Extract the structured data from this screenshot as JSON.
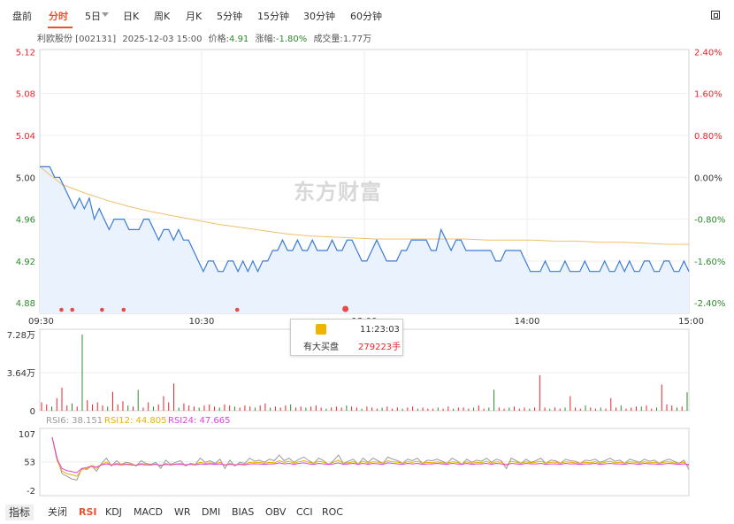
{
  "tabs": [
    {
      "label": "盘前",
      "active": false
    },
    {
      "label": "分时",
      "active": true
    },
    {
      "label": "5日",
      "active": false
    },
    {
      "label": "日K",
      "active": false
    },
    {
      "label": "周K",
      "active": false
    },
    {
      "label": "月K",
      "active": false
    },
    {
      "label": "5分钟",
      "active": false
    },
    {
      "label": "15分钟",
      "active": false
    },
    {
      "label": "30分钟",
      "active": false
    },
    {
      "label": "60分钟",
      "active": false
    }
  ],
  "info": {
    "stock": "利欧股份 [002131]",
    "datetime": "2025-12-03 15:00",
    "price_label": "价格:",
    "price": "4.91",
    "change_label": "涨幅:",
    "change": "-1.80%",
    "volume_label": "成交量:",
    "volume": "1.77万"
  },
  "watermark": "东方财富",
  "tooltip": {
    "label": "有大买盘",
    "time": "11:23:03",
    "volume": "279223手"
  },
  "bottom_tabs": [
    {
      "label": "指标",
      "active": false
    },
    {
      "label": "关闭",
      "active": false
    },
    {
      "label": "RSI",
      "active": true
    },
    {
      "label": "KDJ",
      "active": false
    },
    {
      "label": "MACD",
      "active": false
    },
    {
      "label": "WR",
      "active": false
    },
    {
      "label": "DMI",
      "active": false
    },
    {
      "label": "BIAS",
      "active": false
    },
    {
      "label": "OBV",
      "active": false
    },
    {
      "label": "CCI",
      "active": false
    },
    {
      "label": "ROC",
      "active": false
    }
  ],
  "colors": {
    "up": "#e8242b",
    "down": "#2d8a2d",
    "price_line": "#3a7bd5",
    "avg_line": "#f0c06a",
    "rsi6": "#9a9a9a",
    "rsi12": "#e8b000",
    "rsi24": "#e040e0"
  },
  "chart_data": [
    {
      "type": "line",
      "title": "",
      "x_ticks": [
        "09:30",
        "10:30",
        "13:00",
        "14:00",
        "15:00"
      ],
      "y_ticks": [
        "5.12",
        "5.08",
        "5.04",
        "5.00",
        "4.96",
        "4.92",
        "4.88"
      ],
      "pct_ticks": [
        "2.40%",
        "1.60%",
        "0.80%",
        "0.00%",
        "-0.80%",
        "-1.60%",
        "-2.40%"
      ],
      "ylim": [
        4.87,
        5.122
      ],
      "base_price": 5.0,
      "series": [
        {
          "name": "price",
          "values": [
            5.01,
            5.01,
            5.01,
            5.0,
            5.0,
            4.99,
            4.98,
            4.97,
            4.98,
            4.97,
            4.98,
            4.96,
            4.97,
            4.96,
            4.95,
            4.96,
            4.96,
            4.96,
            4.95,
            4.95,
            4.95,
            4.96,
            4.96,
            4.95,
            4.94,
            4.95,
            4.95,
            4.94,
            4.95,
            4.94,
            4.94,
            4.93,
            4.92,
            4.91,
            4.92,
            4.92,
            4.91,
            4.91,
            4.92,
            4.92,
            4.91,
            4.92,
            4.91,
            4.92,
            4.91,
            4.92,
            4.92,
            4.93,
            4.93,
            4.94,
            4.93,
            4.93,
            4.94,
            4.93,
            4.93,
            4.94,
            4.93,
            4.93,
            4.93,
            4.94,
            4.93,
            4.93,
            4.94,
            4.94,
            4.93,
            4.92,
            4.92,
            4.93,
            4.94,
            4.93,
            4.92,
            4.92,
            4.92,
            4.93,
            4.93,
            4.94,
            4.94,
            4.94,
            4.94,
            4.93,
            4.93,
            4.95,
            4.94,
            4.93,
            4.94,
            4.94,
            4.93,
            4.93,
            4.93,
            4.93,
            4.93,
            4.93,
            4.92,
            4.92,
            4.93,
            4.93,
            4.93,
            4.93,
            4.92,
            4.91,
            4.91,
            4.91,
            4.92,
            4.91,
            4.91,
            4.91,
            4.92,
            4.91,
            4.91,
            4.91,
            4.92,
            4.91,
            4.91,
            4.91,
            4.92,
            4.91,
            4.91,
            4.92,
            4.91,
            4.92,
            4.91,
            4.91,
            4.92,
            4.92,
            4.91,
            4.91,
            4.92,
            4.92,
            4.91,
            4.91,
            4.92,
            4.91
          ]
        },
        {
          "name": "average",
          "values": [
            5.01,
            4.993,
            4.985,
            4.978,
            4.972,
            4.967,
            4.963,
            4.959,
            4.955,
            4.952,
            4.949,
            4.946,
            4.944,
            4.943,
            4.942,
            4.941,
            4.941,
            4.941,
            4.941,
            4.941,
            4.94,
            4.94,
            4.94,
            4.939,
            4.939,
            4.938,
            4.938,
            4.937,
            4.936,
            4.936
          ]
        }
      ],
      "markers_x": [
        "09:38",
        "09:42",
        "09:53",
        "10:01",
        "10:43",
        "11:23"
      ]
    },
    {
      "type": "bar",
      "title": "",
      "y_ticks": [
        "7.28万",
        "3.64万",
        "0"
      ],
      "ylim": [
        0,
        72800
      ],
      "values": [
        8000,
        6000,
        4000,
        12000,
        22000,
        5000,
        7000,
        4000,
        72800,
        10000,
        6000,
        8000,
        5000,
        4000,
        18000,
        6000,
        9000,
        5000,
        4000,
        20000,
        3000,
        8000,
        4000,
        6000,
        14000,
        8000,
        26000,
        3000,
        7000,
        5000,
        4000,
        3000,
        5000,
        6000,
        4000,
        3000,
        6000,
        5000,
        4000,
        3000,
        5000,
        4000,
        3000,
        5000,
        7000,
        3000,
        4000,
        3000,
        5000,
        6000,
        3000,
        4000,
        3000,
        4000,
        5000,
        3000,
        2000,
        3000,
        4000,
        3000,
        5000,
        4000,
        3000,
        2000,
        4000,
        3000,
        2000,
        3000,
        4000,
        2000,
        3000,
        2000,
        3000,
        4000,
        2000,
        3000,
        2000,
        2000,
        3000,
        2000,
        4000,
        2000,
        3000,
        3000,
        2000,
        3000,
        5000,
        2000,
        3000,
        20000,
        3000,
        2000,
        3000,
        4000,
        2000,
        3000,
        2000,
        3000,
        34000,
        3000,
        2000,
        3000,
        2000,
        3000,
        14000,
        3000,
        2000,
        5000,
        3000,
        2000,
        3000,
        2000,
        12000,
        3000,
        5000,
        2000,
        3000,
        4000,
        4000,
        5000,
        2000,
        3000,
        25000,
        6000,
        5000,
        3000,
        4000,
        17700
      ],
      "up_flags": [
        1,
        1,
        0,
        1,
        1,
        1,
        0,
        1,
        0,
        1,
        1,
        1,
        1,
        0,
        1,
        1,
        1,
        0,
        1,
        0,
        1,
        1,
        0,
        1,
        1,
        1,
        1,
        0,
        1,
        1,
        1,
        0,
        1,
        1,
        1,
        0,
        1,
        1,
        0,
        1,
        1,
        1,
        0,
        1,
        1,
        0,
        1,
        1,
        1,
        0,
        1,
        1,
        0,
        1,
        1,
        1,
        0,
        1,
        1,
        1,
        0,
        1,
        1,
        0,
        1,
        1,
        1,
        0,
        1,
        1,
        1,
        0,
        1,
        1,
        0,
        1,
        1,
        1,
        0,
        1,
        1,
        0,
        1,
        1,
        1,
        0,
        1,
        1,
        0,
        0,
        1,
        1,
        0,
        1,
        1,
        1,
        0,
        1,
        1,
        1,
        0,
        1,
        1,
        0,
        1,
        1,
        1,
        0,
        1,
        1,
        0,
        1,
        1,
        1,
        0,
        1,
        1,
        1,
        0,
        1,
        1,
        0,
        1,
        1,
        1,
        0,
        1,
        0
      ]
    },
    {
      "type": "line",
      "title": "",
      "y_ticks": [
        "107",
        "53",
        "-2"
      ],
      "ylim": [
        -2,
        107
      ],
      "series": [
        {
          "name": "RSI6: 38.151",
          "values": [
            100,
            60,
            30,
            25,
            20,
            18,
            40,
            38,
            45,
            35,
            50,
            60,
            45,
            55,
            48,
            52,
            50,
            45,
            55,
            50,
            48,
            52,
            40,
            56,
            48,
            52,
            55,
            45,
            50,
            48,
            60,
            52,
            55,
            50,
            58,
            40,
            56,
            45,
            52,
            50,
            60,
            54,
            56,
            52,
            58,
            55,
            66,
            55,
            60,
            52,
            58,
            62,
            55,
            50,
            60,
            55,
            48,
            55,
            66,
            50,
            54,
            58,
            48,
            60,
            52,
            60,
            55,
            50,
            62,
            58,
            55,
            50,
            58,
            55,
            60,
            50,
            56,
            55,
            58,
            54,
            50,
            60,
            55,
            48,
            58,
            52,
            56,
            54,
            60,
            52,
            58,
            55,
            40,
            60,
            55,
            50,
            58,
            52,
            55,
            60,
            50,
            56,
            55,
            50,
            58,
            55,
            54,
            50,
            56,
            55,
            58,
            52,
            55,
            60,
            54,
            56,
            50,
            58,
            55,
            52,
            58,
            54,
            56,
            50,
            55,
            58,
            54,
            50,
            56,
            38
          ]
        },
        {
          "name": "RSI12: 44.805",
          "values": [
            100,
            55,
            35,
            30,
            28,
            25,
            38,
            40,
            44,
            40,
            48,
            52,
            47,
            50,
            48,
            49,
            48,
            46,
            50,
            48,
            47,
            49,
            45,
            50,
            47,
            49,
            50,
            47,
            49,
            48,
            52,
            50,
            51,
            49,
            52,
            46,
            50,
            47,
            49,
            48,
            52,
            51,
            52,
            50,
            52,
            51,
            55,
            52,
            54,
            50,
            53,
            55,
            52,
            50,
            54,
            52,
            49,
            52,
            56,
            50,
            51,
            53,
            49,
            54,
            50,
            53,
            52,
            50,
            55,
            53,
            52,
            50,
            53,
            52,
            54,
            50,
            52,
            51,
            53,
            51,
            50,
            53,
            52,
            49,
            53,
            50,
            52,
            51,
            54,
            50,
            53,
            52,
            47,
            54,
            52,
            50,
            53,
            51,
            52,
            54,
            50,
            52,
            52,
            50,
            53,
            52,
            51,
            50,
            52,
            51,
            53,
            50,
            52,
            54,
            51,
            52,
            50,
            53,
            52,
            50,
            53,
            51,
            52,
            50,
            52,
            53,
            51,
            50,
            52,
            44.805
          ]
        },
        {
          "name": "RSI24: 47.665",
          "values": [
            100,
            58,
            40,
            36,
            34,
            32,
            40,
            42,
            45,
            43,
            47,
            49,
            47,
            48,
            47,
            48,
            47,
            46,
            48,
            47,
            47,
            48,
            46,
            48,
            47,
            48,
            48,
            47,
            48,
            47,
            49,
            48,
            49,
            48,
            49,
            47,
            48,
            47,
            48,
            47,
            49,
            49,
            49,
            48,
            49,
            49,
            51,
            49,
            50,
            48,
            50,
            51,
            49,
            48,
            50,
            49,
            48,
            49,
            51,
            48,
            49,
            50,
            48,
            50,
            48,
            50,
            49,
            48,
            51,
            50,
            49,
            48,
            50,
            49,
            50,
            48,
            49,
            49,
            50,
            49,
            48,
            50,
            49,
            48,
            50,
            48,
            49,
            49,
            50,
            48,
            50,
            49,
            47,
            50,
            49,
            48,
            50,
            49,
            49,
            50,
            48,
            49,
            49,
            48,
            50,
            49,
            49,
            48,
            49,
            49,
            50,
            48,
            49,
            50,
            49,
            49,
            48,
            50,
            49,
            48,
            50,
            49,
            49,
            48,
            49,
            50,
            49,
            48,
            49,
            47.665
          ]
        }
      ]
    }
  ]
}
